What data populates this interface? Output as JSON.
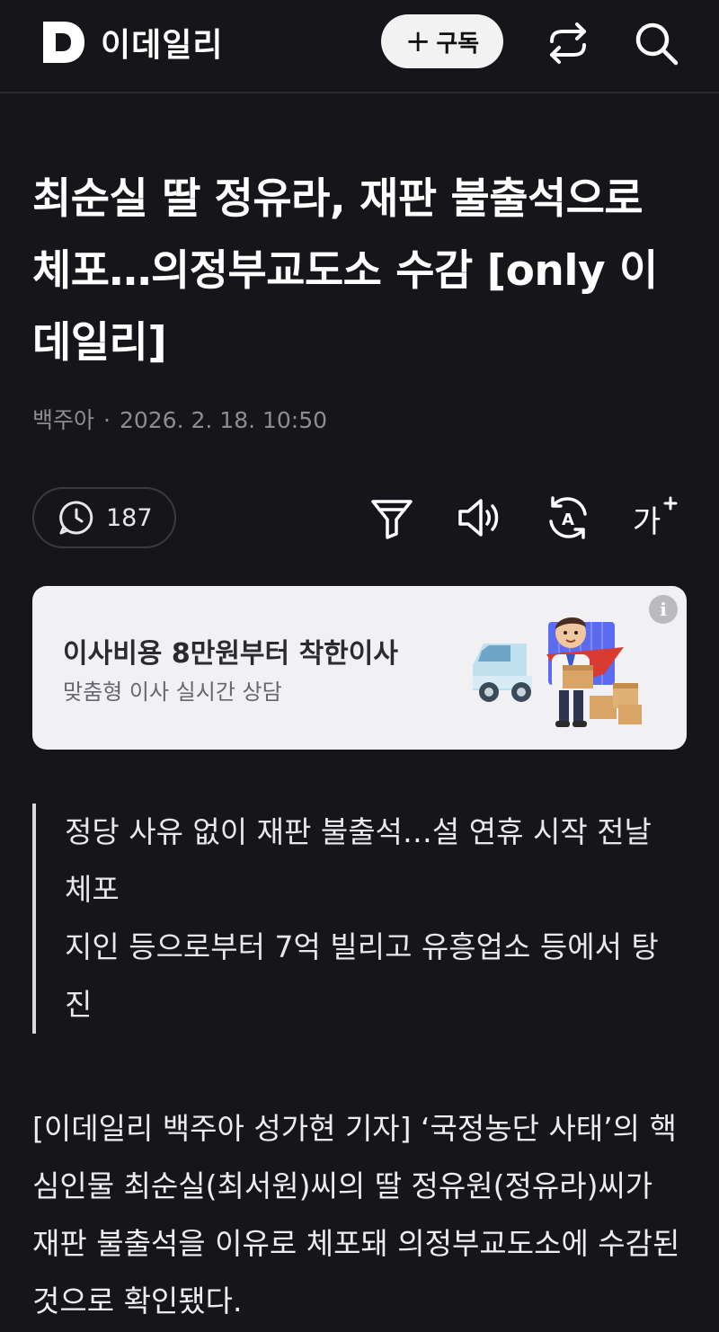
{
  "header": {
    "logo_letter": "D",
    "logo_text": "이데일리",
    "subscribe_label": "구독",
    "subscribe_plus": "+",
    "icons": [
      "share-icon",
      "search-icon"
    ]
  },
  "article": {
    "title": "최순실 딸 정유라, 재판 불출석으로 체포…의정부교도소 수감 [only 이데일리]",
    "author": "백주아",
    "separator": "·",
    "datetime": "2026. 2. 18. 10:50",
    "comment_count": "187",
    "tool_icons": [
      "filter-icon",
      "audio-icon",
      "translate-icon",
      "font-size-icon"
    ],
    "font_size_label": "가",
    "translate_label": "A",
    "summary": [
      "정당 사유 없이 재판 불출석…설 연휴 시작 전날 체포",
      "지인 등으로부터 7억 빌리고 유흥업소 등에서 탕진"
    ],
    "body": "[이데일리 백주아 성가현 기자] ‘국정농단 사태’의 핵심인물 최순실(최서원)씨의 딸 정유원(정유라)씨가 재판 불출석을 이유로 체포돼 의정부교도소에 수감된 것으로 확인됐다."
  },
  "ad": {
    "title": "이사비용 8만원부터 착한이사",
    "subtitle": "맞춤형 이사 실시간 상담",
    "info_label": "i"
  },
  "colors": {
    "background": "#16161a",
    "text": "#ffffff",
    "muted": "#8c8c92",
    "ad_background": "#f1f1f3"
  }
}
